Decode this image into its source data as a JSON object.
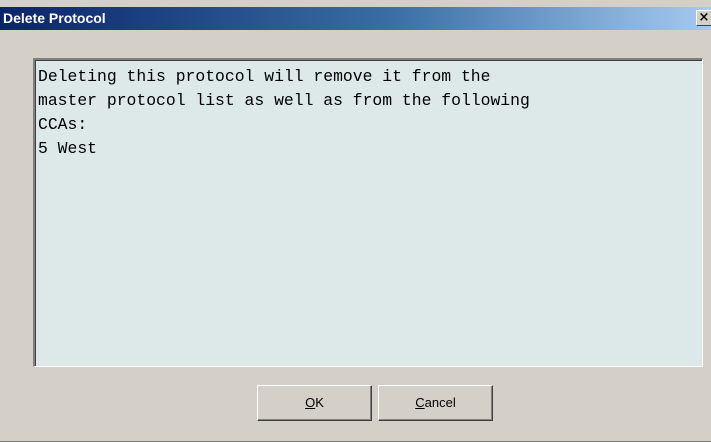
{
  "window": {
    "title": "Delete Protocol",
    "close_glyph": "×"
  },
  "message": {
    "lines": [
      "Deleting this protocol will remove it from the",
      "master protocol list as well as from the following",
      "CCAs:",
      "5 West"
    ]
  },
  "buttons": {
    "ok": {
      "mnemonic": "O",
      "rest": "K"
    },
    "cancel": {
      "mnemonic": "C",
      "rest": "ancel"
    }
  },
  "colors": {
    "title_bar_start": "#0a246a",
    "title_bar_end": "#a6caf0",
    "dialog_background": "#d4d0c8",
    "message_background": "#dde9e9"
  }
}
